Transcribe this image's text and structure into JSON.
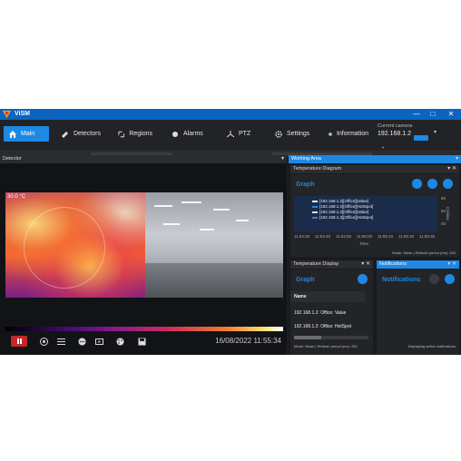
{
  "app": {
    "title": "ViSM",
    "accent": "#1e88e5",
    "titlebar_color": "#0b64c0"
  },
  "window_controls": {
    "minimize": "—",
    "maximize": "□",
    "close": "✕"
  },
  "nav": {
    "items": [
      {
        "label": "Main",
        "icon": "home-icon"
      },
      {
        "label": "Detectors",
        "icon": "camera-icon"
      },
      {
        "label": "Regions",
        "icon": "region-icon"
      },
      {
        "label": "Alarms",
        "icon": "alarm-icon"
      },
      {
        "label": "PTZ",
        "icon": "ptz-icon"
      },
      {
        "label": "Settings",
        "icon": "gear-icon"
      },
      {
        "label": "Information",
        "icon": "info-icon"
      }
    ],
    "active": "Main"
  },
  "current_camera": {
    "label": "Current camera",
    "value": "192.168.1.2"
  },
  "detector": {
    "header": "Detector",
    "thermal_label": "30.0 °C",
    "timestamp": "16/08/2022 11:55:34"
  },
  "working_area": {
    "header": "Working Area",
    "temperature_diagram": {
      "header": "Temperature Diagram",
      "graph_title": "Graph",
      "legend": [
        {
          "text": "[192.168.1.2][Office][Value]",
          "color": "#ffffff"
        },
        {
          "text": "[192.168.1.2][Office][HotSpot]",
          "color": "#1e88e5"
        },
        {
          "text": "[192.168.1.2][Office][Value]",
          "color": "#e0e0e0"
        },
        {
          "text": "[192.168.1.2][Office][HotSpot]",
          "color": "#5c6bc0"
        }
      ],
      "y_ticks": [
        "80",
        "60",
        "40"
      ],
      "y_label": "Celsius",
      "x_ticks": [
        "11:54:30",
        "11:54:40",
        "11:54:50",
        "11:55:00",
        "11:55:10",
        "11:55:20",
        "11:55:30"
      ],
      "x_label": "Time",
      "status": "Mode: Mean | Refresh period (ms): 200"
    },
    "temperature_display": {
      "header": "Temperature Display",
      "graph_title": "Graph",
      "column": "Name",
      "rows": [
        "192.168.1.2: Office: Value",
        "192.168.1.2: Office: HotSpot"
      ],
      "status": "Mode: Mean | Refresh period (ms): 200"
    },
    "notifications": {
      "header": "Notifications",
      "title": "Notifications",
      "status": "Displaying active notifications"
    }
  }
}
